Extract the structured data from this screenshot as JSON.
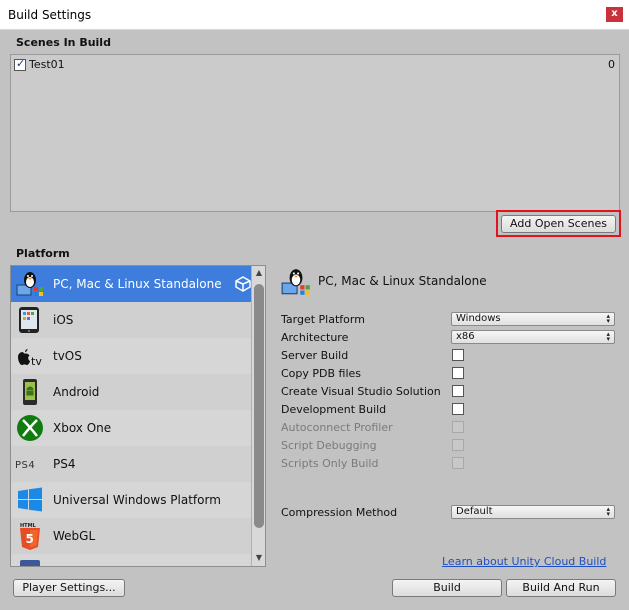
{
  "window": {
    "title": "Build Settings",
    "close_label": "x"
  },
  "scenes": {
    "header": "Scenes In Build",
    "items": [
      {
        "name": "Test01",
        "index": "0",
        "checked": true
      }
    ],
    "add_open_scenes_label": "Add Open Scenes"
  },
  "platform": {
    "header": "Platform",
    "items": [
      {
        "label": "PC, Mac & Linux Standalone",
        "icon": "pc-mac-linux-icon",
        "selected": true
      },
      {
        "label": "iOS",
        "icon": "ios-icon",
        "selected": false
      },
      {
        "label": "tvOS",
        "icon": "tvos-icon",
        "selected": false
      },
      {
        "label": "Android",
        "icon": "android-icon",
        "selected": false
      },
      {
        "label": "Xbox One",
        "icon": "xbox-one-icon",
        "selected": false
      },
      {
        "label": "PS4",
        "icon": "ps4-icon",
        "selected": false
      },
      {
        "label": "Universal Windows Platform",
        "icon": "windows-icon",
        "selected": false
      },
      {
        "label": "WebGL",
        "icon": "html5-icon",
        "selected": false
      }
    ]
  },
  "details": {
    "title": "PC, Mac & Linux Standalone",
    "target_platform_label": "Target Platform",
    "target_platform_value": "Windows",
    "architecture_label": "Architecture",
    "architecture_value": "x86",
    "server_build_label": "Server Build",
    "copy_pdb_label": "Copy PDB files",
    "create_vs_label": "Create Visual Studio Solution",
    "development_build_label": "Development Build",
    "autoconnect_profiler_label": "Autoconnect Profiler",
    "script_debugging_label": "Script Debugging",
    "scripts_only_label": "Scripts Only Build",
    "compression_label": "Compression Method",
    "compression_value": "Default"
  },
  "footer": {
    "cloud_link": "Learn about Unity Cloud Build",
    "player_settings_label": "Player Settings...",
    "build_label": "Build",
    "build_and_run_label": "Build And Run"
  },
  "colors": {
    "selection": "#3e7ddb",
    "highlight_outline": "#e0141c",
    "panel_background": "#c2c2c2",
    "link": "#1f4fc2"
  }
}
